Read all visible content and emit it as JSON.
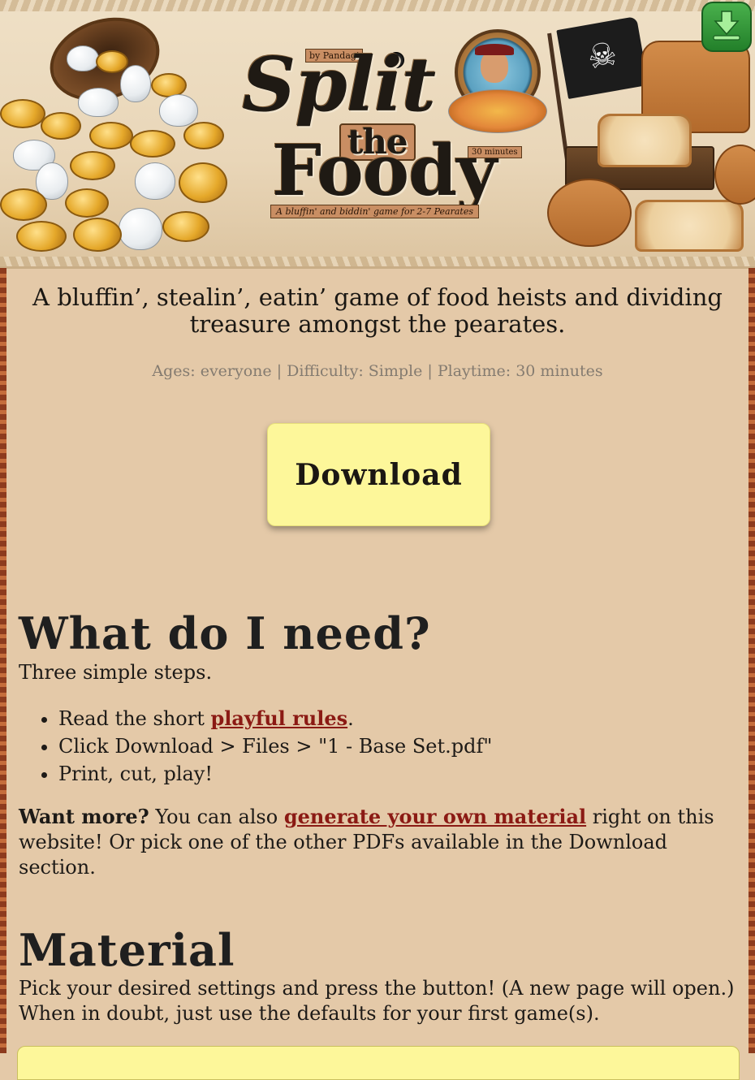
{
  "banner": {
    "byline": "by Pandagi",
    "logo_line1": "Split",
    "logo_line2": "the",
    "logo_line3": "Foody",
    "playtime_tag": "30 minutes",
    "tagline": "A bluffin' and biddin' game for 2-7 Pearates",
    "corner_icon": "download-arrow-icon"
  },
  "intro": {
    "subtitle": "A bluffin’, stealin’, eatin’ game of food heists and dividing treasure amongst the pearates.",
    "meta": "Ages: everyone | Difficulty: Simple | Playtime: 30 minutes"
  },
  "download_button": {
    "label": "Download"
  },
  "need_section": {
    "heading": "What do I need?",
    "lead": "Three simple steps.",
    "step1_prefix": "Read the short ",
    "step1_link": "playful rules",
    "step1_suffix": ".",
    "step2": "Click Download > Files > \"1 - Base Set.pdf\"",
    "step3": "Print, cut, play!",
    "more_bold": "Want more?",
    "more_prefix": " You can also ",
    "more_link": "generate your own material",
    "more_suffix": " right on this website! Or pick one of the other PDFs available in the Download section."
  },
  "material_section": {
    "heading": "Material",
    "text": "Pick your desired settings and press the button! (A new page will open.) When in doubt, just use the defaults for your first game(s)."
  },
  "colors": {
    "background": "#e4c9a8",
    "button": "#fdf79a",
    "link": "#8b1a14",
    "meta_text": "#847b70"
  }
}
